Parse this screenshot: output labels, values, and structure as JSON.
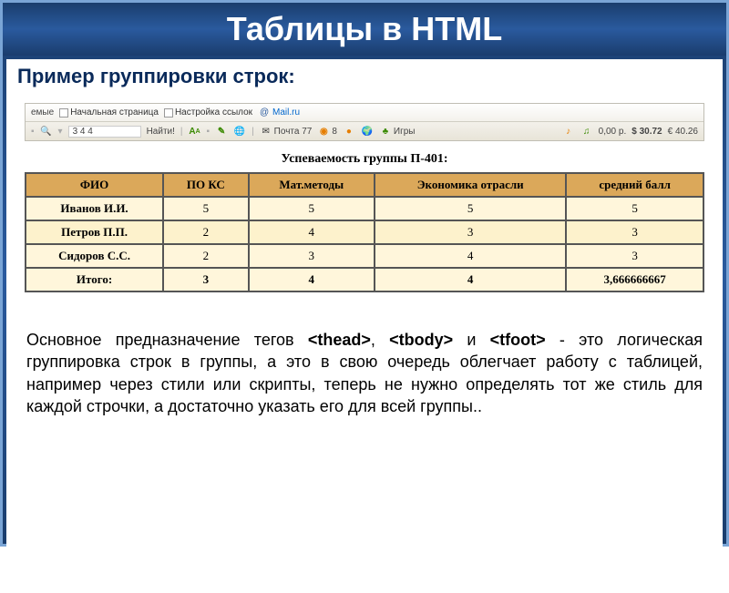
{
  "title": "Таблицы в HTML",
  "subtitle": "Пример группировки строк:",
  "toolbar": {
    "row1": [
      "емые",
      "Начальная страница",
      "Настройка ссылок",
      "Mail.ru"
    ],
    "search_value": "3  4  4",
    "find_btn": "Найти!",
    "mail": "Почта 77",
    "friends": "8",
    "games": "Игры",
    "balance": "0,00 р.",
    "usd": "$ 30.72",
    "eur": "€ 40.26"
  },
  "table": {
    "caption": "Успеваемость группы П-401:",
    "headers": [
      "ФИО",
      "ПО КС",
      "Мат.методы",
      "Экономика отрасли",
      "средний балл"
    ],
    "rows": [
      [
        "Иванов И.И.",
        "5",
        "5",
        "5",
        "5"
      ],
      [
        "Петров П.П.",
        "2",
        "4",
        "3",
        "3"
      ],
      [
        "Сидоров С.С.",
        "2",
        "3",
        "4",
        "3"
      ]
    ],
    "footer": [
      "Итого:",
      "3",
      "4",
      "4",
      "3,666666667"
    ]
  },
  "explanation": {
    "p1a": "Основное предназначение тегов ",
    "t1": "<thead>",
    "p1b": ", ",
    "t2": "<tbody>",
    "p1c": " и ",
    "t3": "<tfoot>",
    "p1d": " - это логическая группировка строк в группы, а это в свою очередь облегчает работу с таблицей, например через стили или скрипты, теперь не нужно определять тот же стиль для каждой строчки, а достаточно указать его для всей группы.."
  }
}
